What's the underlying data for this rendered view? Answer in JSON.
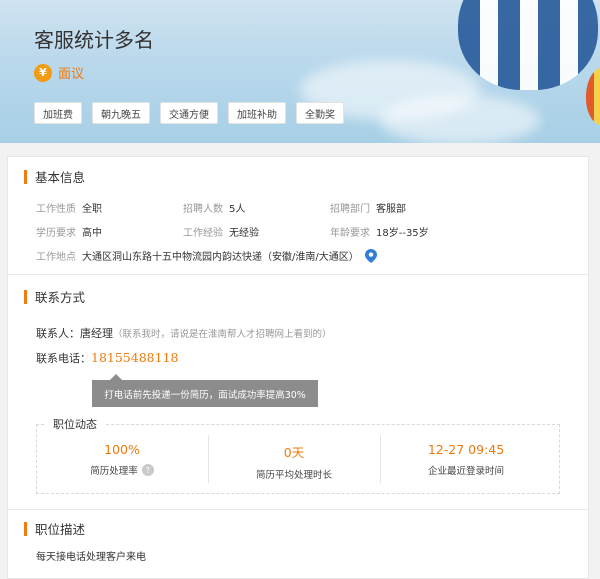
{
  "header": {
    "title": "客服统计多名",
    "salary": "面议",
    "yen_symbol": "¥",
    "tags": [
      "加班费",
      "朝九晚五",
      "交通方便",
      "加班补助",
      "全勤奖"
    ]
  },
  "basic_info": {
    "title": "基本信息",
    "fields": [
      {
        "label": "工作性质",
        "value": "全职"
      },
      {
        "label": "招聘人数",
        "value": "5人"
      },
      {
        "label": "招聘部门",
        "value": "客服部"
      },
      {
        "label": "学历要求",
        "value": "高中"
      },
      {
        "label": "工作经验",
        "value": "无经验"
      },
      {
        "label": "年龄要求",
        "value": "18岁--35岁"
      }
    ],
    "location_label": "工作地点",
    "location_value": "大通区洞山东路十五中物流园内韵达快递（安徽/淮南/大通区）"
  },
  "contact": {
    "title": "联系方式",
    "person_label": "联系人：",
    "person_name": "唐经理",
    "person_hint": "（联系我时，请说是在淮南帮人才招聘网上看到的）",
    "phone_label": "联系电话：",
    "phone": "18155488118",
    "tooltip": "打电话前先投递一份简历，面试成功率提高30%"
  },
  "dynamics": {
    "title": "职位动态",
    "stats": [
      {
        "value": "100%",
        "label": "简历处理率"
      },
      {
        "value": "0天",
        "label": "简历平均处理时长"
      },
      {
        "value": "12-27 09:45",
        "label": "企业最近登录时间"
      }
    ],
    "help_symbol": "?"
  },
  "description": {
    "title": "职位描述",
    "text": "每天接电话处理客户来电"
  },
  "colors": {
    "accent": "#f07b0e",
    "hero_sky": "#b9d8ec"
  }
}
